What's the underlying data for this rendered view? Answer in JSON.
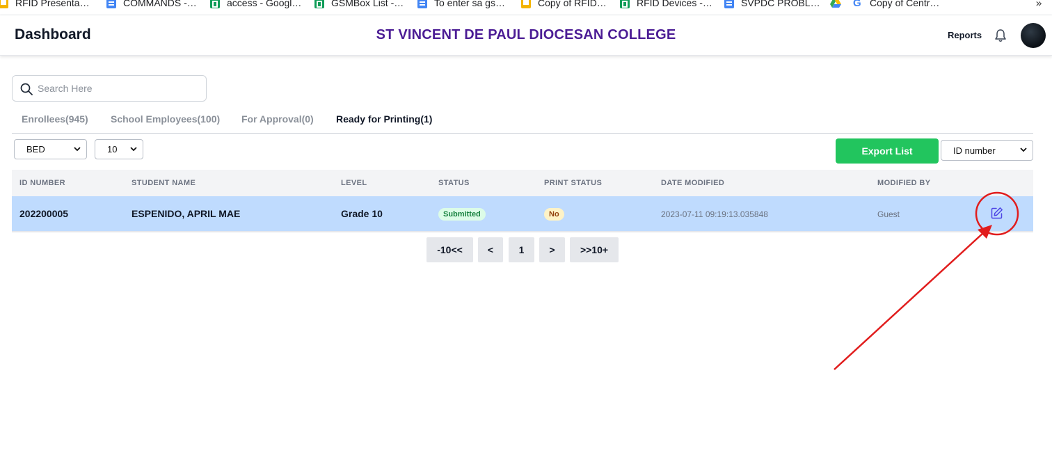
{
  "bookmarks": [
    {
      "label": "RFID Presenta…",
      "icon": "slides-icon"
    },
    {
      "label": "COMMANDS -…",
      "icon": "docs-icon"
    },
    {
      "label": "access - Googl…",
      "icon": "sheets-icon"
    },
    {
      "label": "GSMBox List -…",
      "icon": "sheets-icon"
    },
    {
      "label": "To enter sa gs…",
      "icon": "docs-icon"
    },
    {
      "label": "Copy of RFID…",
      "icon": "slides-icon"
    },
    {
      "label": "RFID Devices -…",
      "icon": "sheets-icon"
    },
    {
      "label": "SVPDC PROBL…",
      "icon": "docs-icon"
    },
    {
      "label": "",
      "icon": "drive-icon"
    },
    {
      "label": "Copy of Centr…",
      "icon": "google-icon"
    }
  ],
  "bookmarks_more": "»",
  "header": {
    "title": "Dashboard",
    "school_name": "ST VINCENT DE PAUL DIOCESAN COLLEGE",
    "reports_label": "Reports",
    "school_color": "#4c1d95"
  },
  "search": {
    "placeholder": "Search Here",
    "value": ""
  },
  "tabs": [
    {
      "label": "Enrollees(945)",
      "active": false
    },
    {
      "label": "School Employees(100)",
      "active": false
    },
    {
      "label": "For Approval(0)",
      "active": false
    },
    {
      "label": "Ready for Printing(1)",
      "active": true
    }
  ],
  "toolbar": {
    "department_select": "BED",
    "page_size_select": "10",
    "export_label": "Export List",
    "export_color": "#22c55e",
    "sort_select": "ID number"
  },
  "table": {
    "columns": [
      "ID NUMBER",
      "STUDENT NAME",
      "LEVEL",
      "STATUS",
      "PRINT STATUS",
      "DATE MODIFIED",
      "MODIFIED BY"
    ],
    "rows": [
      {
        "id_number": "202200005",
        "student_name": "ESPENIDO, APRIL MAE",
        "level": "Grade 10",
        "status": "Submitted",
        "print_status": "No",
        "date_modified": "2023-07-11 09:19:13.035848",
        "modified_by": "Guest"
      }
    ],
    "row_highlight_color": "#bfdbfe"
  },
  "pagination": {
    "prev10_label": "-10<<",
    "prev_label": "<",
    "current_page": "1",
    "next_label": ">",
    "next10_label": ">>10+"
  },
  "annotation_color": "#e11d1d"
}
